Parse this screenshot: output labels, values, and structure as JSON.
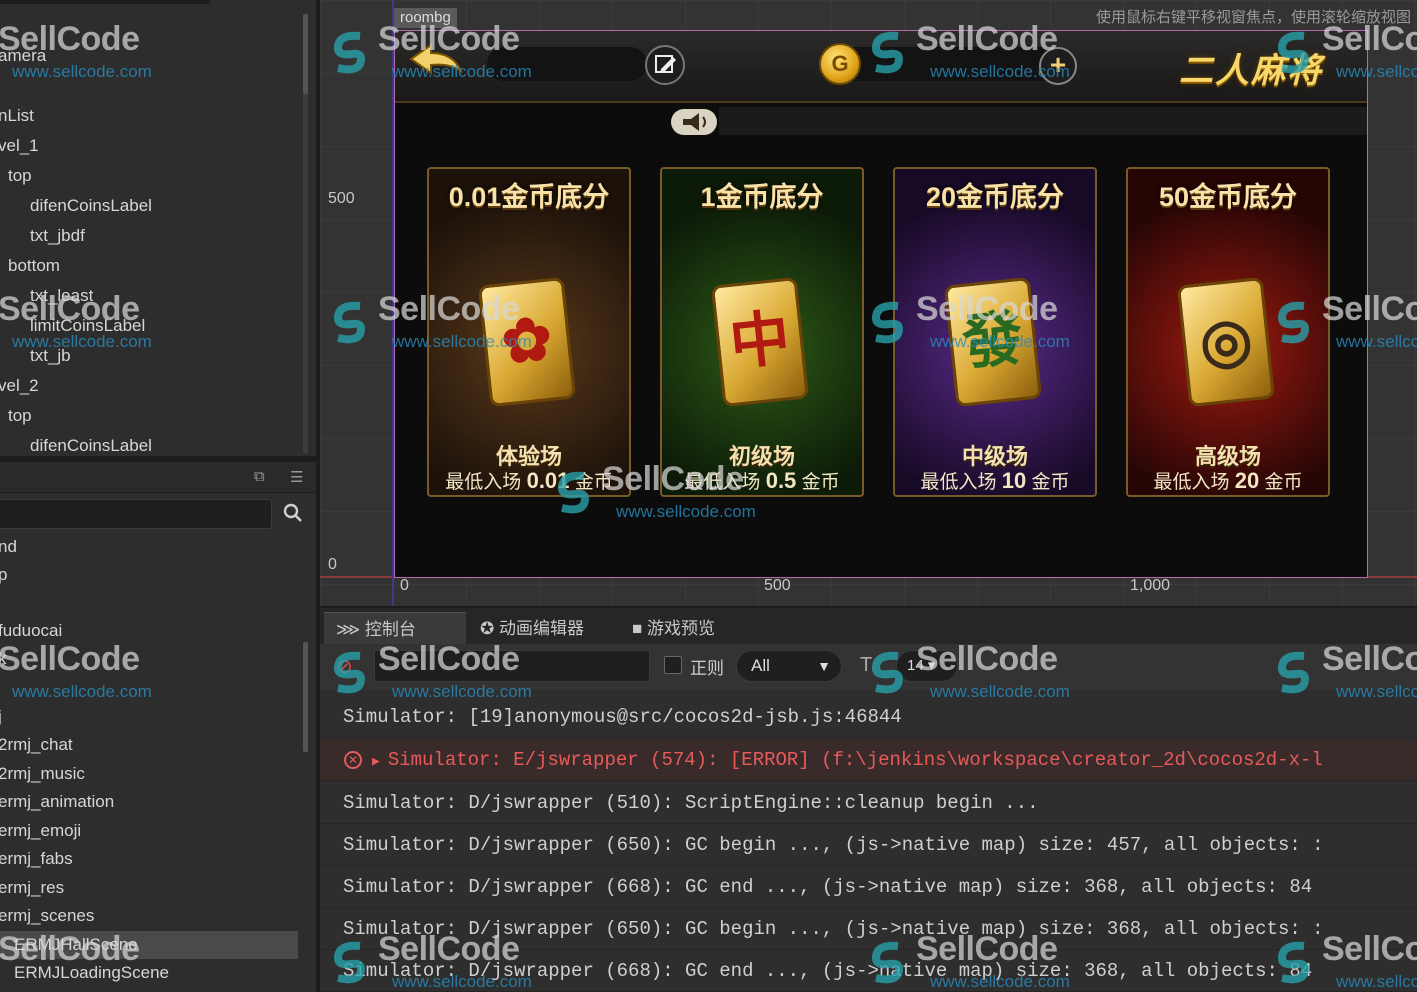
{
  "hierarchy": {
    "nodes": [
      {
        "label": "amera"
      },
      {
        "label": ""
      },
      {
        "label": "nList"
      },
      {
        "label": "vel_1"
      },
      {
        "label": "top"
      },
      {
        "label": "difenCoinsLabel"
      },
      {
        "label": "txt_jbdf"
      },
      {
        "label": "bottom"
      },
      {
        "label": "txt_least"
      },
      {
        "label": "limitCoinsLabel"
      },
      {
        "label": "txt_jb"
      },
      {
        "label": "vel_2"
      },
      {
        "label": "top"
      },
      {
        "label": "difenCoinsLabel"
      }
    ]
  },
  "assets": {
    "items": [
      {
        "label": "nd"
      },
      {
        "label": "p"
      },
      {
        "label": ""
      },
      {
        "label": "fuduocai"
      },
      {
        "label": "k"
      },
      {
        "label": ""
      },
      {
        "label": "j"
      },
      {
        "label": "2rmj_chat"
      },
      {
        "label": "2rmj_music"
      },
      {
        "label": "ermj_animation"
      },
      {
        "label": "ermj_emoji"
      },
      {
        "label": "ermj_fabs"
      },
      {
        "label": "ermj_res"
      },
      {
        "label": "ermj_scenes"
      },
      {
        "label": "ERMJHallScene"
      },
      {
        "label": "ERMJLoadingScene"
      }
    ]
  },
  "scene": {
    "hint": "使用鼠标右键平移视窗焦点，使用滚轮缩放视图",
    "node_tag": "roombg",
    "ruler_y_500": "500",
    "ruler_y_0": "0",
    "ruler_x_0": "0",
    "ruler_x_500": "500",
    "ruler_x_1000": "1,000"
  },
  "game": {
    "title": "二人麻将",
    "coin_symbol": "G",
    "plus_symbol": "+",
    "rooms": [
      {
        "cap": "0.01金币底分",
        "tile": "✿",
        "level": "体验场",
        "min_prefix": "最低入场",
        "min_value": "0.01",
        "min_suffix": "金币",
        "color": "#5a3a1a"
      },
      {
        "cap": "1金币底分",
        "tile": "中",
        "level": "初级场",
        "min_prefix": "最低入场",
        "min_value": "0.5",
        "min_suffix": "金币",
        "color": "#2d5a16"
      },
      {
        "cap": "20金币底分",
        "tile": "發",
        "level": "中级场",
        "min_prefix": "最低入场",
        "min_value": "10",
        "min_suffix": "金币",
        "color": "#5a2a8a"
      },
      {
        "cap": "50金币底分",
        "tile": "◎",
        "level": "高级场",
        "min_prefix": "最低入场",
        "min_value": "20",
        "min_suffix": "金币",
        "color": "#a01a10"
      }
    ]
  },
  "console": {
    "tabs": [
      {
        "label": "控制台",
        "icon": "console-icon"
      },
      {
        "label": "动画编辑器",
        "icon": "animation-icon"
      },
      {
        "label": "游戏预览",
        "icon": "video-icon"
      }
    ],
    "regex_label": "正则",
    "level_select": "All",
    "font_size": "14",
    "lines": [
      {
        "text": "Simulator: [19]anonymous@src/cocos2d-jsb.js:46844",
        "error": false
      },
      {
        "text": "Simulator: E/jswrapper (574): [ERROR] (f:\\jenkins\\workspace\\creator_2d\\cocos2d-x-l",
        "error": true
      },
      {
        "text": "Simulator: D/jswrapper (510): ScriptEngine::cleanup begin ...",
        "error": false
      },
      {
        "text": "Simulator: D/jswrapper (650): GC begin ..., (js->native map) size: 457, all objects: :",
        "error": false
      },
      {
        "text": "Simulator: D/jswrapper (668): GC end ..., (js->native map) size: 368, all objects: 84",
        "error": false
      },
      {
        "text": "Simulator: D/jswrapper (650): GC begin ..., (js->native map) size: 368, all objects: :",
        "error": false
      },
      {
        "text": "Simulator: D/jswrapper (668): GC end ..., (js->native map) size: 368, all objects: 84",
        "error": false
      }
    ]
  },
  "watermark": {
    "brand": "SellCode",
    "url": "www.sellcode.com"
  }
}
